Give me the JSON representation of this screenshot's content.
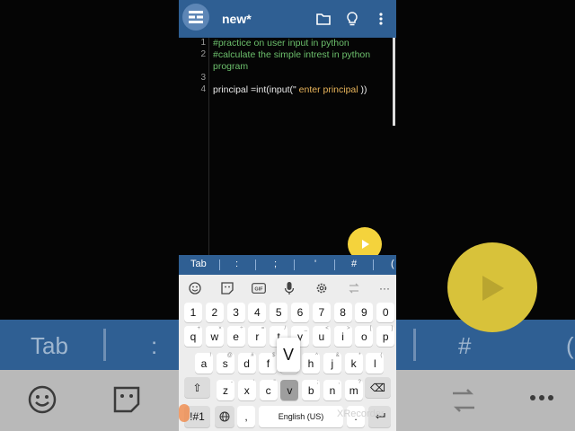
{
  "app": {
    "title": "new*"
  },
  "editor": {
    "line_numbers": [
      "1",
      "2",
      "3",
      "4"
    ],
    "lines": [
      {
        "text": "#practice on user input in python",
        "kind": "comment"
      },
      {
        "text": "#calculate the simple intrest in python",
        "kind": "comment"
      },
      {
        "text": "program",
        "kind": "comment"
      },
      {
        "text": "",
        "kind": "plain"
      },
      {
        "code_prefix": "principal =int(input(\"",
        "code_string": "  enter principal ",
        "code_suffix": "))"
      }
    ]
  },
  "symbol_bar": {
    "items": [
      "Tab",
      ":",
      ";",
      "'",
      "#",
      "("
    ]
  },
  "keyboard": {
    "toolbar_icons": [
      "emoji-icon",
      "sticker-icon",
      "gif-icon",
      "mic-icon",
      "settings-icon",
      "translate-icon",
      "more-icon"
    ],
    "gif_label": "GIF",
    "more_label": "···",
    "row_numbers": [
      "1",
      "2",
      "3",
      "4",
      "5",
      "6",
      "7",
      "8",
      "9",
      "0"
    ],
    "row1": [
      {
        "k": "q",
        "s": "+"
      },
      {
        "k": "w",
        "s": "×"
      },
      {
        "k": "e",
        "s": "÷"
      },
      {
        "k": "r",
        "s": "="
      },
      {
        "k": "t",
        "s": "/"
      },
      {
        "k": "y",
        "s": "_"
      },
      {
        "k": "u",
        "s": "<"
      },
      {
        "k": "i",
        "s": ">"
      },
      {
        "k": "o",
        "s": "["
      },
      {
        "k": "p",
        "s": "]"
      }
    ],
    "row2": [
      {
        "k": "a",
        "s": "!"
      },
      {
        "k": "s",
        "s": "@"
      },
      {
        "k": "d",
        "s": "#"
      },
      {
        "k": "f",
        "s": "$"
      },
      {
        "k": "g",
        "s": "%"
      },
      {
        "k": "h",
        "s": "^"
      },
      {
        "k": "j",
        "s": "&"
      },
      {
        "k": "k",
        "s": "*"
      },
      {
        "k": "l",
        "s": "("
      }
    ],
    "row3": [
      {
        "k": "z",
        "s": "-"
      },
      {
        "k": "x",
        "s": "'"
      },
      {
        "k": "c",
        "s": "\""
      },
      {
        "k": "v",
        "s": ":"
      },
      {
        "k": "b",
        "s": ";"
      },
      {
        "k": "n",
        "s": ","
      },
      {
        "k": "m",
        "s": "?"
      }
    ],
    "shift_label": "⇧",
    "backspace_label": "⌫",
    "symbols_label": "!#1",
    "comma_label": ",",
    "space_label": "English (US)",
    "period_label": ".",
    "popup_key": "V"
  },
  "watermark": "XRecorder",
  "background": {
    "tab_label": "Tab",
    "colon_label": ":",
    "hash_label": "#",
    "paren_label": "("
  },
  "colors": {
    "accent": "#2f5f93",
    "fab": "#f4d33c",
    "comment": "#6cbf6c",
    "string": "#e7b35a"
  }
}
